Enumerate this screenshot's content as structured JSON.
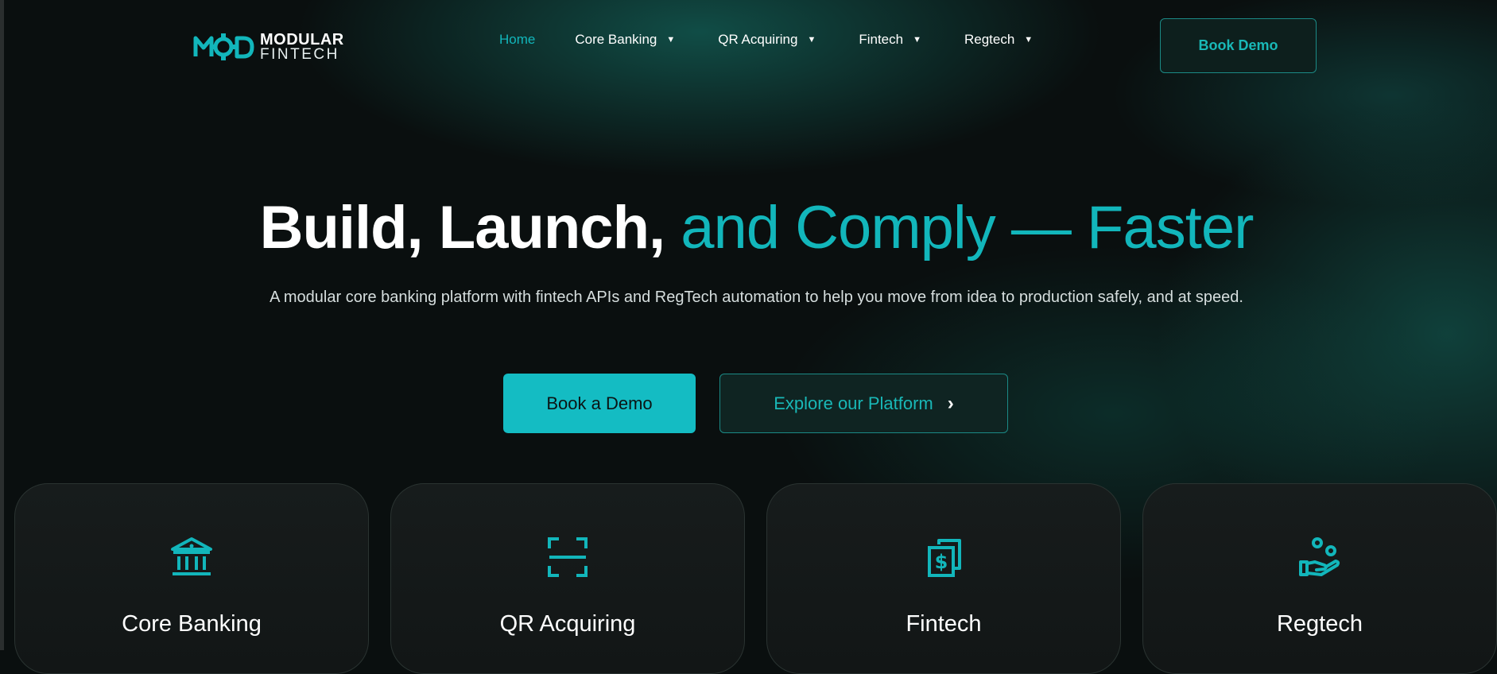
{
  "brand": {
    "line1": "MODULAR",
    "line2": "FINTECH",
    "accent_color": "#12b6bb"
  },
  "nav": {
    "items": [
      {
        "label": "Home",
        "active": true,
        "dropdown": false
      },
      {
        "label": "Core Banking",
        "active": false,
        "dropdown": true
      },
      {
        "label": "QR Acquiring",
        "active": false,
        "dropdown": true
      },
      {
        "label": "Fintech",
        "active": false,
        "dropdown": true
      },
      {
        "label": "Regtech",
        "active": false,
        "dropdown": true
      }
    ],
    "caret_glyph": "▼"
  },
  "header": {
    "cta_label": "Book Demo"
  },
  "hero": {
    "title_plain": "Build, Launch,",
    "title_accent": "and Comply — Faster",
    "subtitle": "A modular core banking platform with fintech APIs and RegTech automation to help you move from idea to production safely, and at speed.",
    "primary_cta": "Book a Demo",
    "secondary_cta": "Explore our Platform",
    "secondary_icon": "chevron-right-icon"
  },
  "cards": [
    {
      "title": "Core Banking",
      "icon": "bank-icon"
    },
    {
      "title": "QR Acquiring",
      "icon": "qr-scan-icon"
    },
    {
      "title": "Fintech",
      "icon": "money-stack-icon"
    },
    {
      "title": "Regtech",
      "icon": "hand-people-icon"
    }
  ]
}
